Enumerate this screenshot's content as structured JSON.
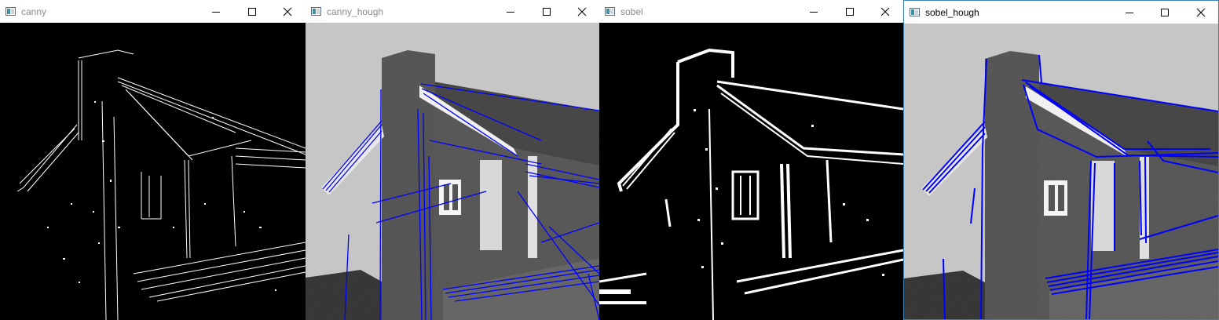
{
  "windows": [
    {
      "title": "canny",
      "active": false
    },
    {
      "title": "canny_hough",
      "active": false
    },
    {
      "title": "sobel",
      "active": false
    },
    {
      "title": "sobel_hough",
      "active": true
    }
  ],
  "icons": {
    "app": "opencv-window-icon",
    "minimize": "minimize-icon",
    "maximize": "maximize-icon",
    "close": "close-icon"
  },
  "colors": {
    "hough_lines": "#0000ff",
    "edge_background": "#000000",
    "edge_foreground": "#ffffff",
    "active_border": "#3c7fb1"
  }
}
